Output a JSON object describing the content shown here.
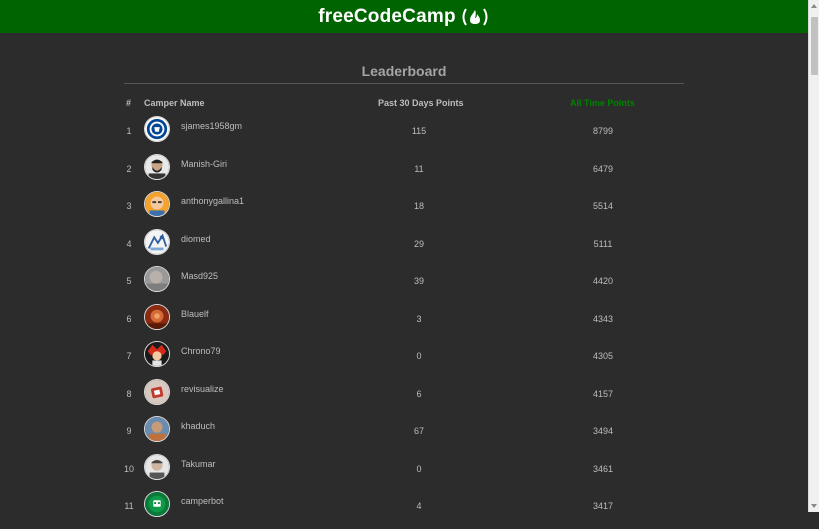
{
  "header": {
    "brand": "freeCodeCamp",
    "logo_icon": "flame-icon",
    "bg_color": "#006400"
  },
  "leaderboard": {
    "title": "Leaderboard",
    "columns": {
      "rank": "#",
      "name": "Camper Name",
      "recent": "Past 30 Days Points",
      "alltime": "All Time Points"
    },
    "accent_color": "#008000",
    "rows": [
      {
        "rank": "1",
        "name": "sjames1958gm",
        "recent": "115",
        "alltime": "8799",
        "avatar": "crest-avatar"
      },
      {
        "rank": "2",
        "name": "Manish-Giri",
        "recent": "11",
        "alltime": "6479",
        "avatar": "bearded-man-avatar"
      },
      {
        "rank": "3",
        "name": "anthonygallina1",
        "recent": "18",
        "alltime": "5514",
        "avatar": "cartoon-man-avatar"
      },
      {
        "rank": "4",
        "name": "diomed",
        "recent": "29",
        "alltime": "5111",
        "avatar": "sketch-avatar"
      },
      {
        "rank": "5",
        "name": "Masd925",
        "recent": "39",
        "alltime": "4420",
        "avatar": "blurred-photo-avatar"
      },
      {
        "rank": "6",
        "name": "Blauelf",
        "recent": "3",
        "alltime": "4343",
        "avatar": "red-photo-avatar"
      },
      {
        "rank": "7",
        "name": "Chrono79",
        "recent": "0",
        "alltime": "4305",
        "avatar": "anime-avatar"
      },
      {
        "rank": "8",
        "name": "revisualize",
        "recent": "6",
        "alltime": "4157",
        "avatar": "logo-avatar"
      },
      {
        "rank": "9",
        "name": "khaduch",
        "recent": "67",
        "alltime": "3494",
        "avatar": "photo-avatar"
      },
      {
        "rank": "10",
        "name": "Takumar",
        "recent": "0",
        "alltime": "3461",
        "avatar": "portrait-avatar"
      },
      {
        "rank": "11",
        "name": "camperbot",
        "recent": "4",
        "alltime": "3417",
        "avatar": "bot-avatar"
      }
    ]
  }
}
